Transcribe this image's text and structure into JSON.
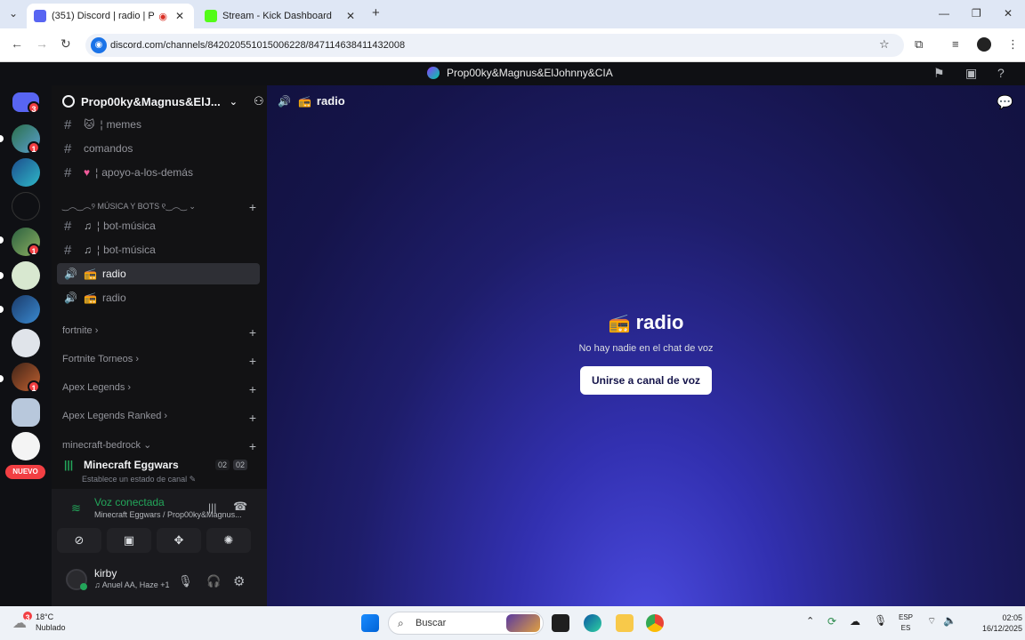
{
  "browser": {
    "tabs": [
      {
        "title": "(351) Discord | radio | P",
        "active": true
      },
      {
        "title": "Stream - Kick Dashboard",
        "active": false
      }
    ],
    "url": "discord.com/channels/842020551015006228/847114638411432008"
  },
  "discord": {
    "window_title": "Prop00ky&Magnus&ElJohnny&CIA",
    "server_badges": [
      "3",
      "1",
      "1",
      "1"
    ],
    "new_label": "NUEVO",
    "guild_name": "Prop00ky&Magnus&ElJ...",
    "channels": {
      "memes": "memes",
      "comandos": "comandos",
      "apoyo": "apoyo-a-los-demás",
      "cat_music": "୨ MÚSICA Y BOTS ୧",
      "bot1": "bot-música",
      "bot2": "bot-música",
      "radio1": "radio",
      "radio2": "radio",
      "cat_fortnite": "fortnite",
      "cat_fortnite_torneos": "Fortnite Torneos",
      "cat_apex": "Apex Legends",
      "cat_apex_ranked": "Apex Legends Ranked",
      "cat_minecraft": "minecraft-bedrock",
      "voice_channel": "Minecraft Eggwars",
      "voice_status_hint": "Establece un estado de canal",
      "voice_counts": [
        "02",
        "02"
      ]
    },
    "voice_panel": {
      "status": "Voz conectada",
      "location": "Minecraft Eggwars / Prop00ky&Magnus..."
    },
    "user": {
      "name": "kirby",
      "activity": "♫ Anuel AA, Haze +1"
    },
    "main": {
      "channel_name": "radio",
      "title": "radio",
      "empty_text": "No hay nadie en el chat de voz",
      "join_button": "Unirse a canal de voz"
    }
  },
  "taskbar": {
    "weather_badge": "3",
    "temperature": "18°C",
    "weather": "Nublado",
    "search_placeholder": "Buscar",
    "lang1": "ESP",
    "lang2": "ES",
    "time": "02:05",
    "date": "16/12/2025"
  },
  "colors": {
    "discord_bg": "#121214",
    "accent_green": "#23a55a",
    "badge_red": "#f23f43"
  }
}
